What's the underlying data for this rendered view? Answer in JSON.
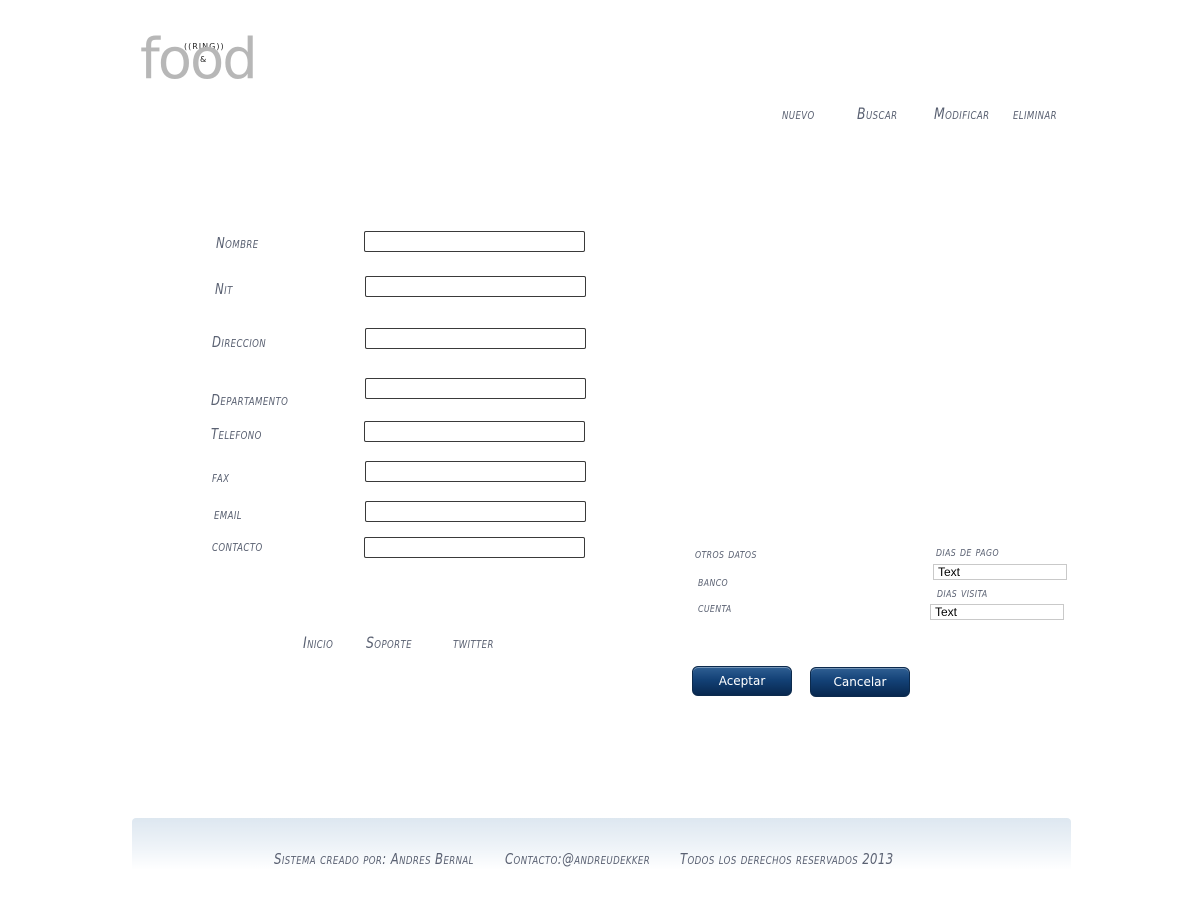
{
  "logo": {
    "ring": "((RING))",
    "amp": "&",
    "word": "food"
  },
  "nav": {
    "items": [
      {
        "label": "nuevo"
      },
      {
        "label": "Buscar"
      },
      {
        "label": "Modificar"
      },
      {
        "label": "eliminar"
      }
    ]
  },
  "form": {
    "fields": [
      {
        "label": "Nombre",
        "value": ""
      },
      {
        "label": "Nit",
        "value": ""
      },
      {
        "label": "Direccion",
        "value": ""
      },
      {
        "label": "Departamento",
        "value": ""
      },
      {
        "label": "Telefono",
        "value": ""
      },
      {
        "label": "fax",
        "value": ""
      },
      {
        "label": "email",
        "value": ""
      },
      {
        "label": "contacto",
        "value": ""
      }
    ]
  },
  "links": {
    "inicio": "Inicio",
    "soporte": "Soporte",
    "twitter": "twitter"
  },
  "otros": {
    "title": "otros datos",
    "banco": "banco",
    "cuenta": "cuenta",
    "dias_pago_label": "dias de pago",
    "dias_pago_value": "Text",
    "dias_visita_label": "dias visita",
    "dias_visita_value": "Text"
  },
  "buttons": {
    "aceptar": "Aceptar",
    "cancelar": "Cancelar"
  },
  "footer": {
    "credit": "Sistema creado por: Andres Bernal",
    "contact": "Contacto:@andreudekker",
    "rights": "Todos los derechos reservados  2013"
  },
  "colors": {
    "label": "#5a6172",
    "button": "#134176",
    "logo": "#b7b7b7"
  }
}
